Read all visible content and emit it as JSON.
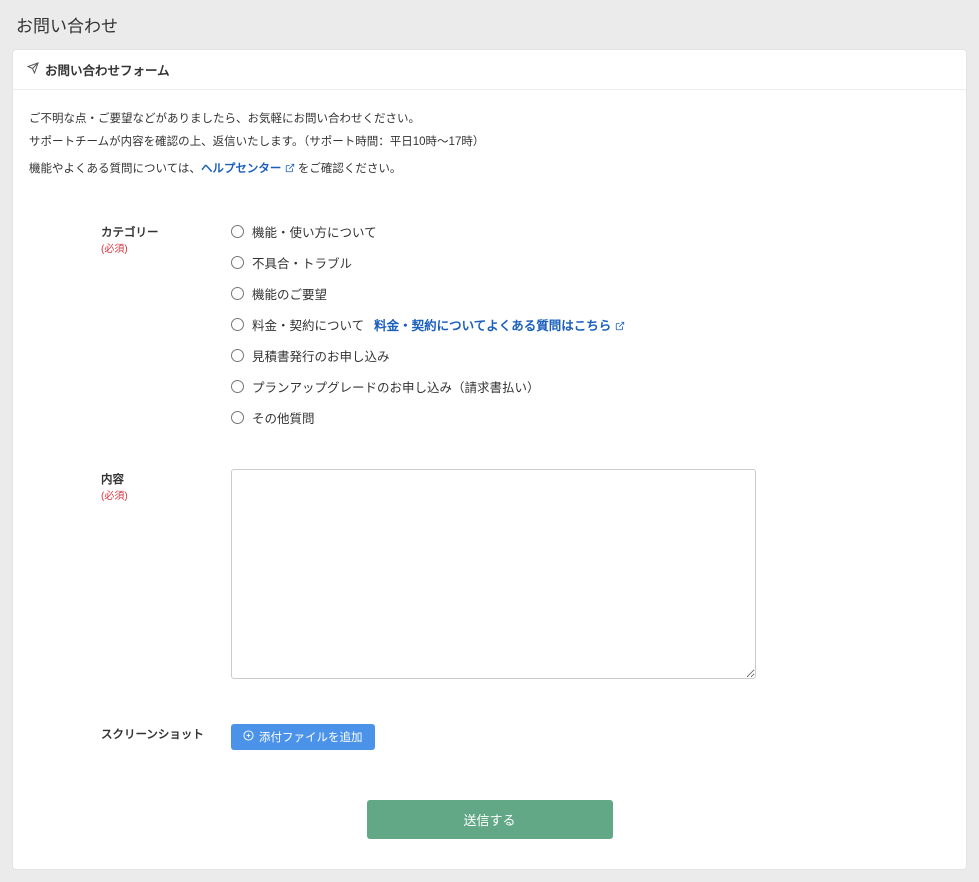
{
  "page": {
    "title": "お問い合わせ"
  },
  "card": {
    "header": "お問い合わせフォーム"
  },
  "intro": {
    "line1": "ご不明な点・ご要望などがありましたら、お気軽にお問い合わせください。",
    "line2": "サポートチームが内容を確認の上、返信いたします。（サポート時間：平日10時〜17時）",
    "line3a": "機能やよくある質問については、",
    "help_link": "ヘルプセンター",
    "line3b": " をご確認ください。"
  },
  "form": {
    "category_label": "カテゴリー",
    "required": "(必須)",
    "categories": [
      "機能・使い方について",
      "不具合・トラブル",
      "機能のご要望",
      "料金・契約について",
      "見積書発行のお申し込み",
      "プランアップグレードのお申し込み（請求書払い）",
      "その他質問"
    ],
    "billing_faq_link": "料金・契約についてよくある質問はこちら",
    "content_label": "内容",
    "screenshot_label": "スクリーンショット",
    "attach_button": "添付ファイルを追加",
    "submit_button": "送信する"
  }
}
